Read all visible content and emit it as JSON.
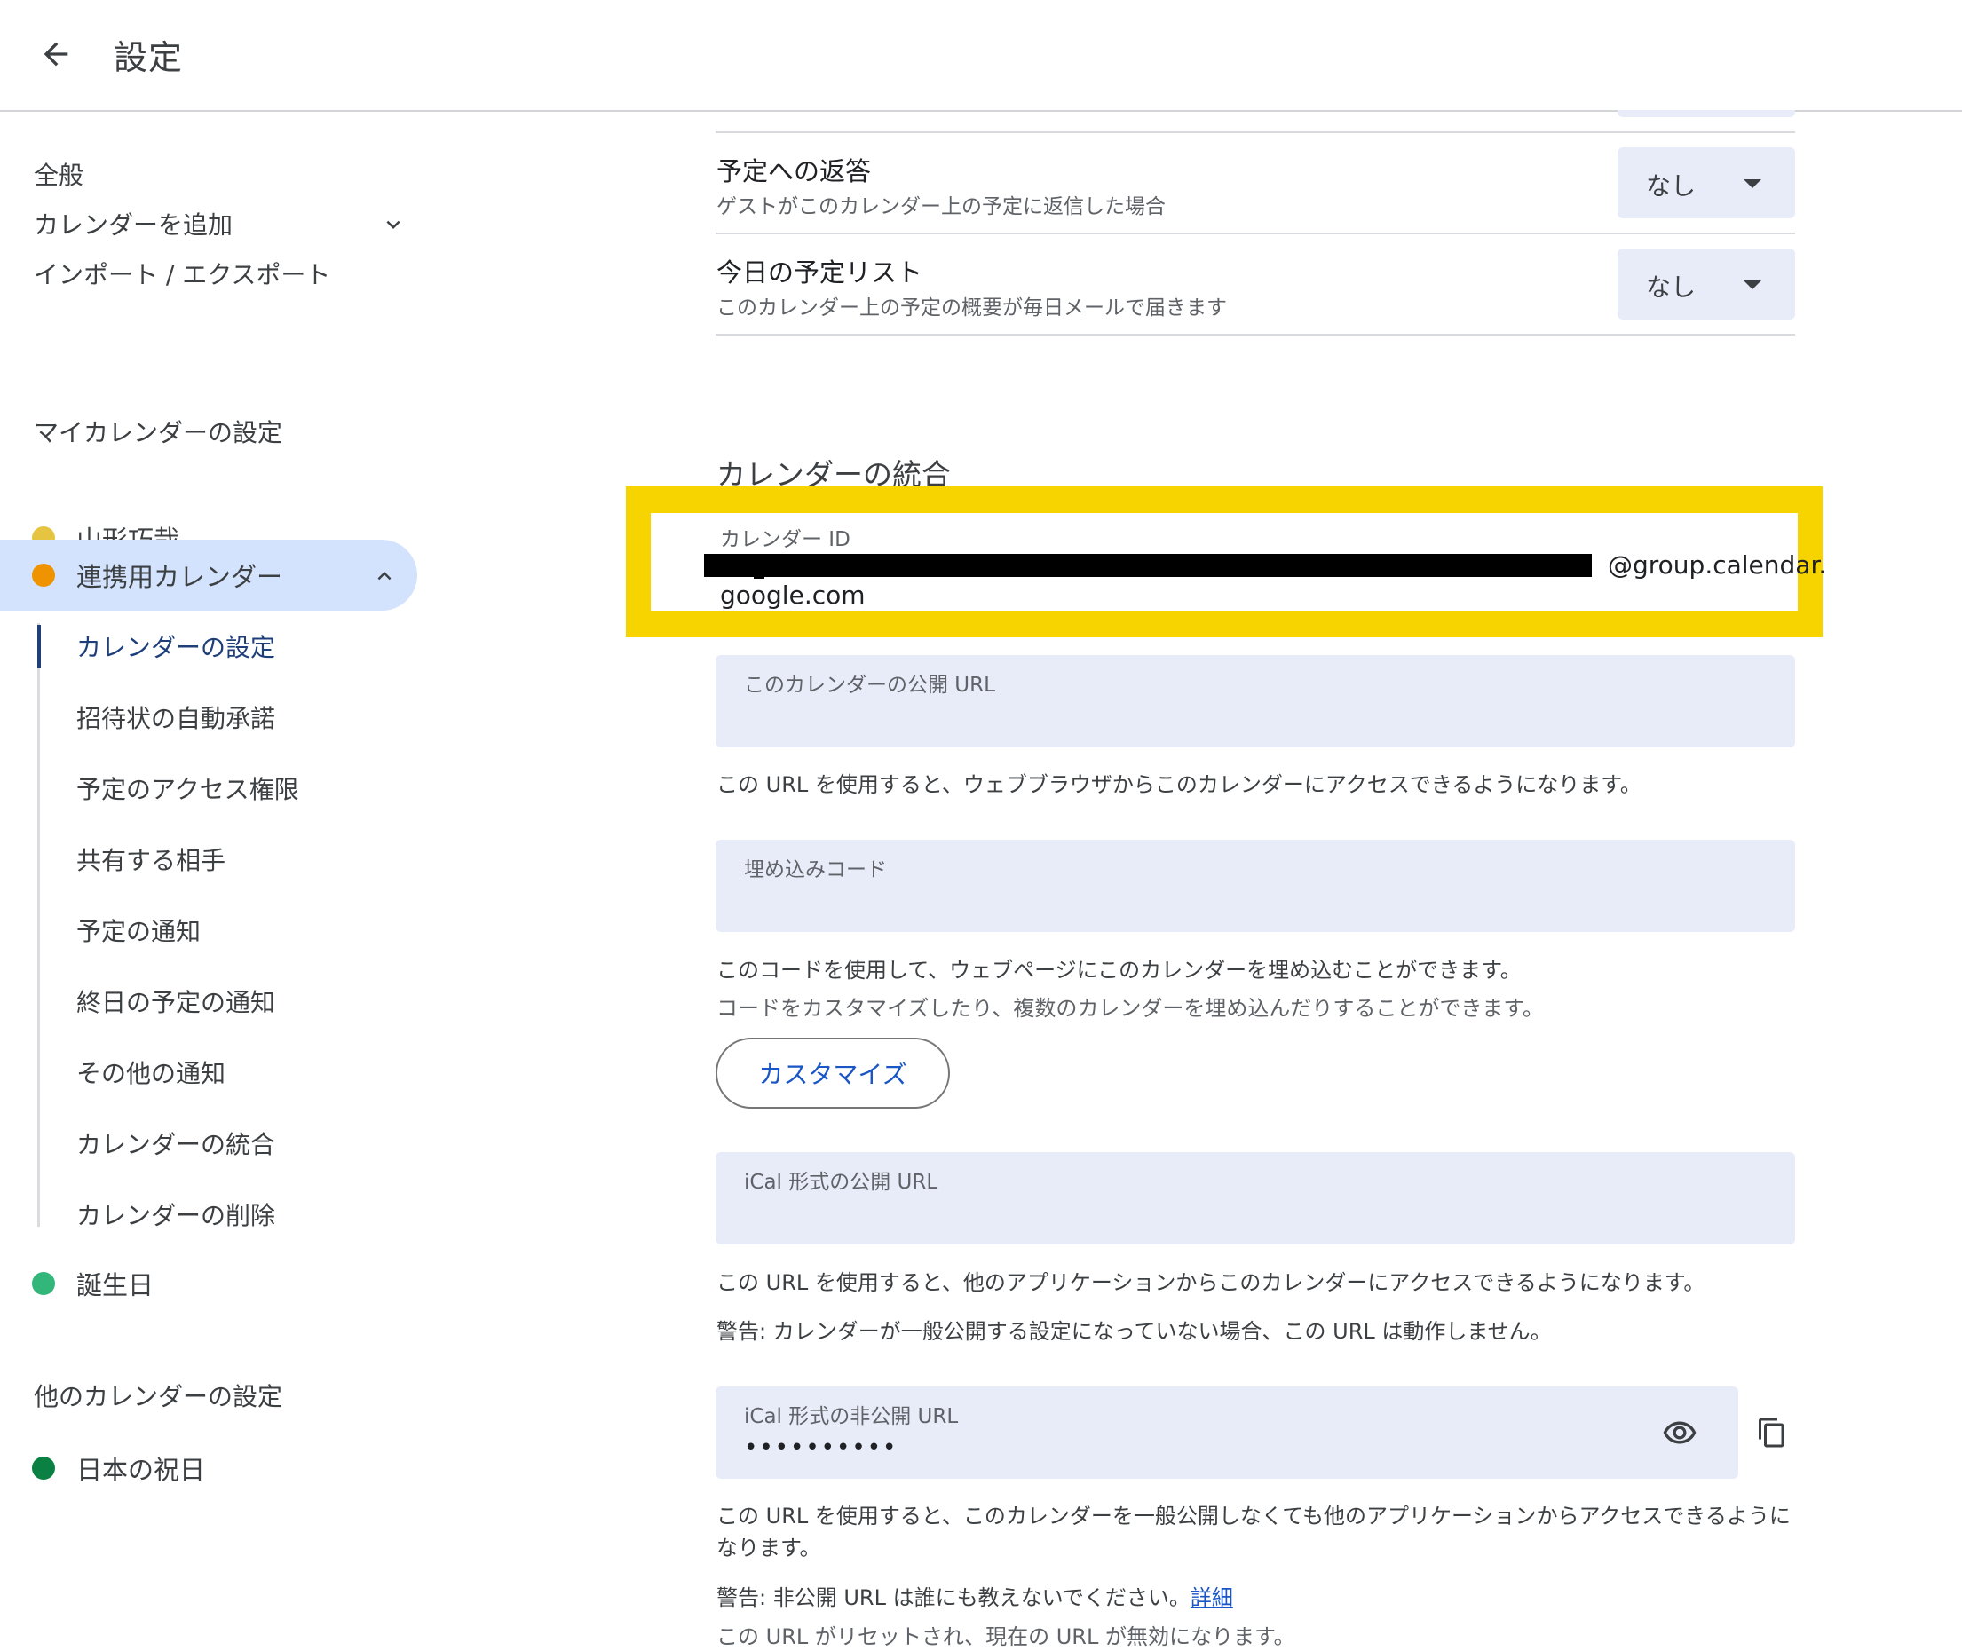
{
  "header": {
    "title": "設定"
  },
  "sidebar": {
    "general": "全般",
    "add_calendar": "カレンダーを追加",
    "import_export": "インポート / エクスポート",
    "my_calendars_heading": "マイカレンダーの設定",
    "my_calendars": [
      {
        "label": "山形巧哉",
        "color": "#e4c441"
      },
      {
        "label": "連携用カレンダー",
        "color": "#f09300"
      }
    ],
    "sub_items": [
      "カレンダーの設定",
      "招待状の自動承諾",
      "予定のアクセス権限",
      "共有する相手",
      "予定の通知",
      "終日の予定の通知",
      "その他の通知",
      "カレンダーの統合",
      "カレンダーの削除"
    ],
    "birthday": {
      "label": "誕生日",
      "color": "#33b679"
    },
    "other_calendars_heading": "他のカレンダーの設定",
    "other_calendars": [
      {
        "label": "日本の祝日",
        "color": "#0b8043"
      }
    ]
  },
  "main": {
    "rows": [
      {
        "title": "予定への返答",
        "subtitle": "ゲストがこのカレンダー上の予定に返信した場合",
        "value": "なし"
      },
      {
        "title": "今日の予定リスト",
        "subtitle": "このカレンダー上の予定の概要が毎日メールで届きます",
        "value": "なし"
      }
    ],
    "integration": {
      "title": "カレンダーの統合",
      "calendar_id_label": "カレンダー ID",
      "calendar_id_suffix": "@group.calendar.",
      "calendar_id_line2": "google.com",
      "public_url_label": "このカレンダーの公開 URL",
      "public_url_help": "この URL を使用すると、ウェブブラウザからこのカレンダーにアクセスできるようになります。",
      "embed_label": "埋め込みコード",
      "embed_help1": "このコードを使用して、ウェブページにこのカレンダーを埋め込むことができます。",
      "embed_help2": "コードをカスタマイズしたり、複数のカレンダーを埋め込んだりすることができます。",
      "customize": "カスタマイズ",
      "ical_public_label": "iCal 形式の公開 URL",
      "ical_public_help": "この URL を使用すると、他のアプリケーションからこのカレンダーにアクセスできるようになります。",
      "ical_public_warning": "警告: カレンダーが一般公開する設定になっていない場合、この URL は動作しません。",
      "ical_private_label": "iCal 形式の非公開 URL",
      "ical_private_value": "••••••••••",
      "ical_private_help1": "この URL を使用すると、このカレンダーを一般公開しなくても他のアプリケーションからアクセスできるように",
      "ical_private_help2": "なります。",
      "ical_private_warning": "警告: 非公開 URL は誰にも教えないでください。",
      "details_link": "詳細",
      "reset_note": "この URL がリセットされ、現在の URL が無効になります。"
    }
  },
  "colors": {
    "highlight": "#f7d300",
    "active_bg": "#d3e3fd",
    "field_bg": "#e8ecf9",
    "link": "#1a56c5"
  },
  "icons": [
    "arrow-back-icon",
    "chevron-down-icon",
    "chevron-up-icon",
    "dropdown-caret-icon",
    "eye-icon",
    "copy-icon"
  ]
}
